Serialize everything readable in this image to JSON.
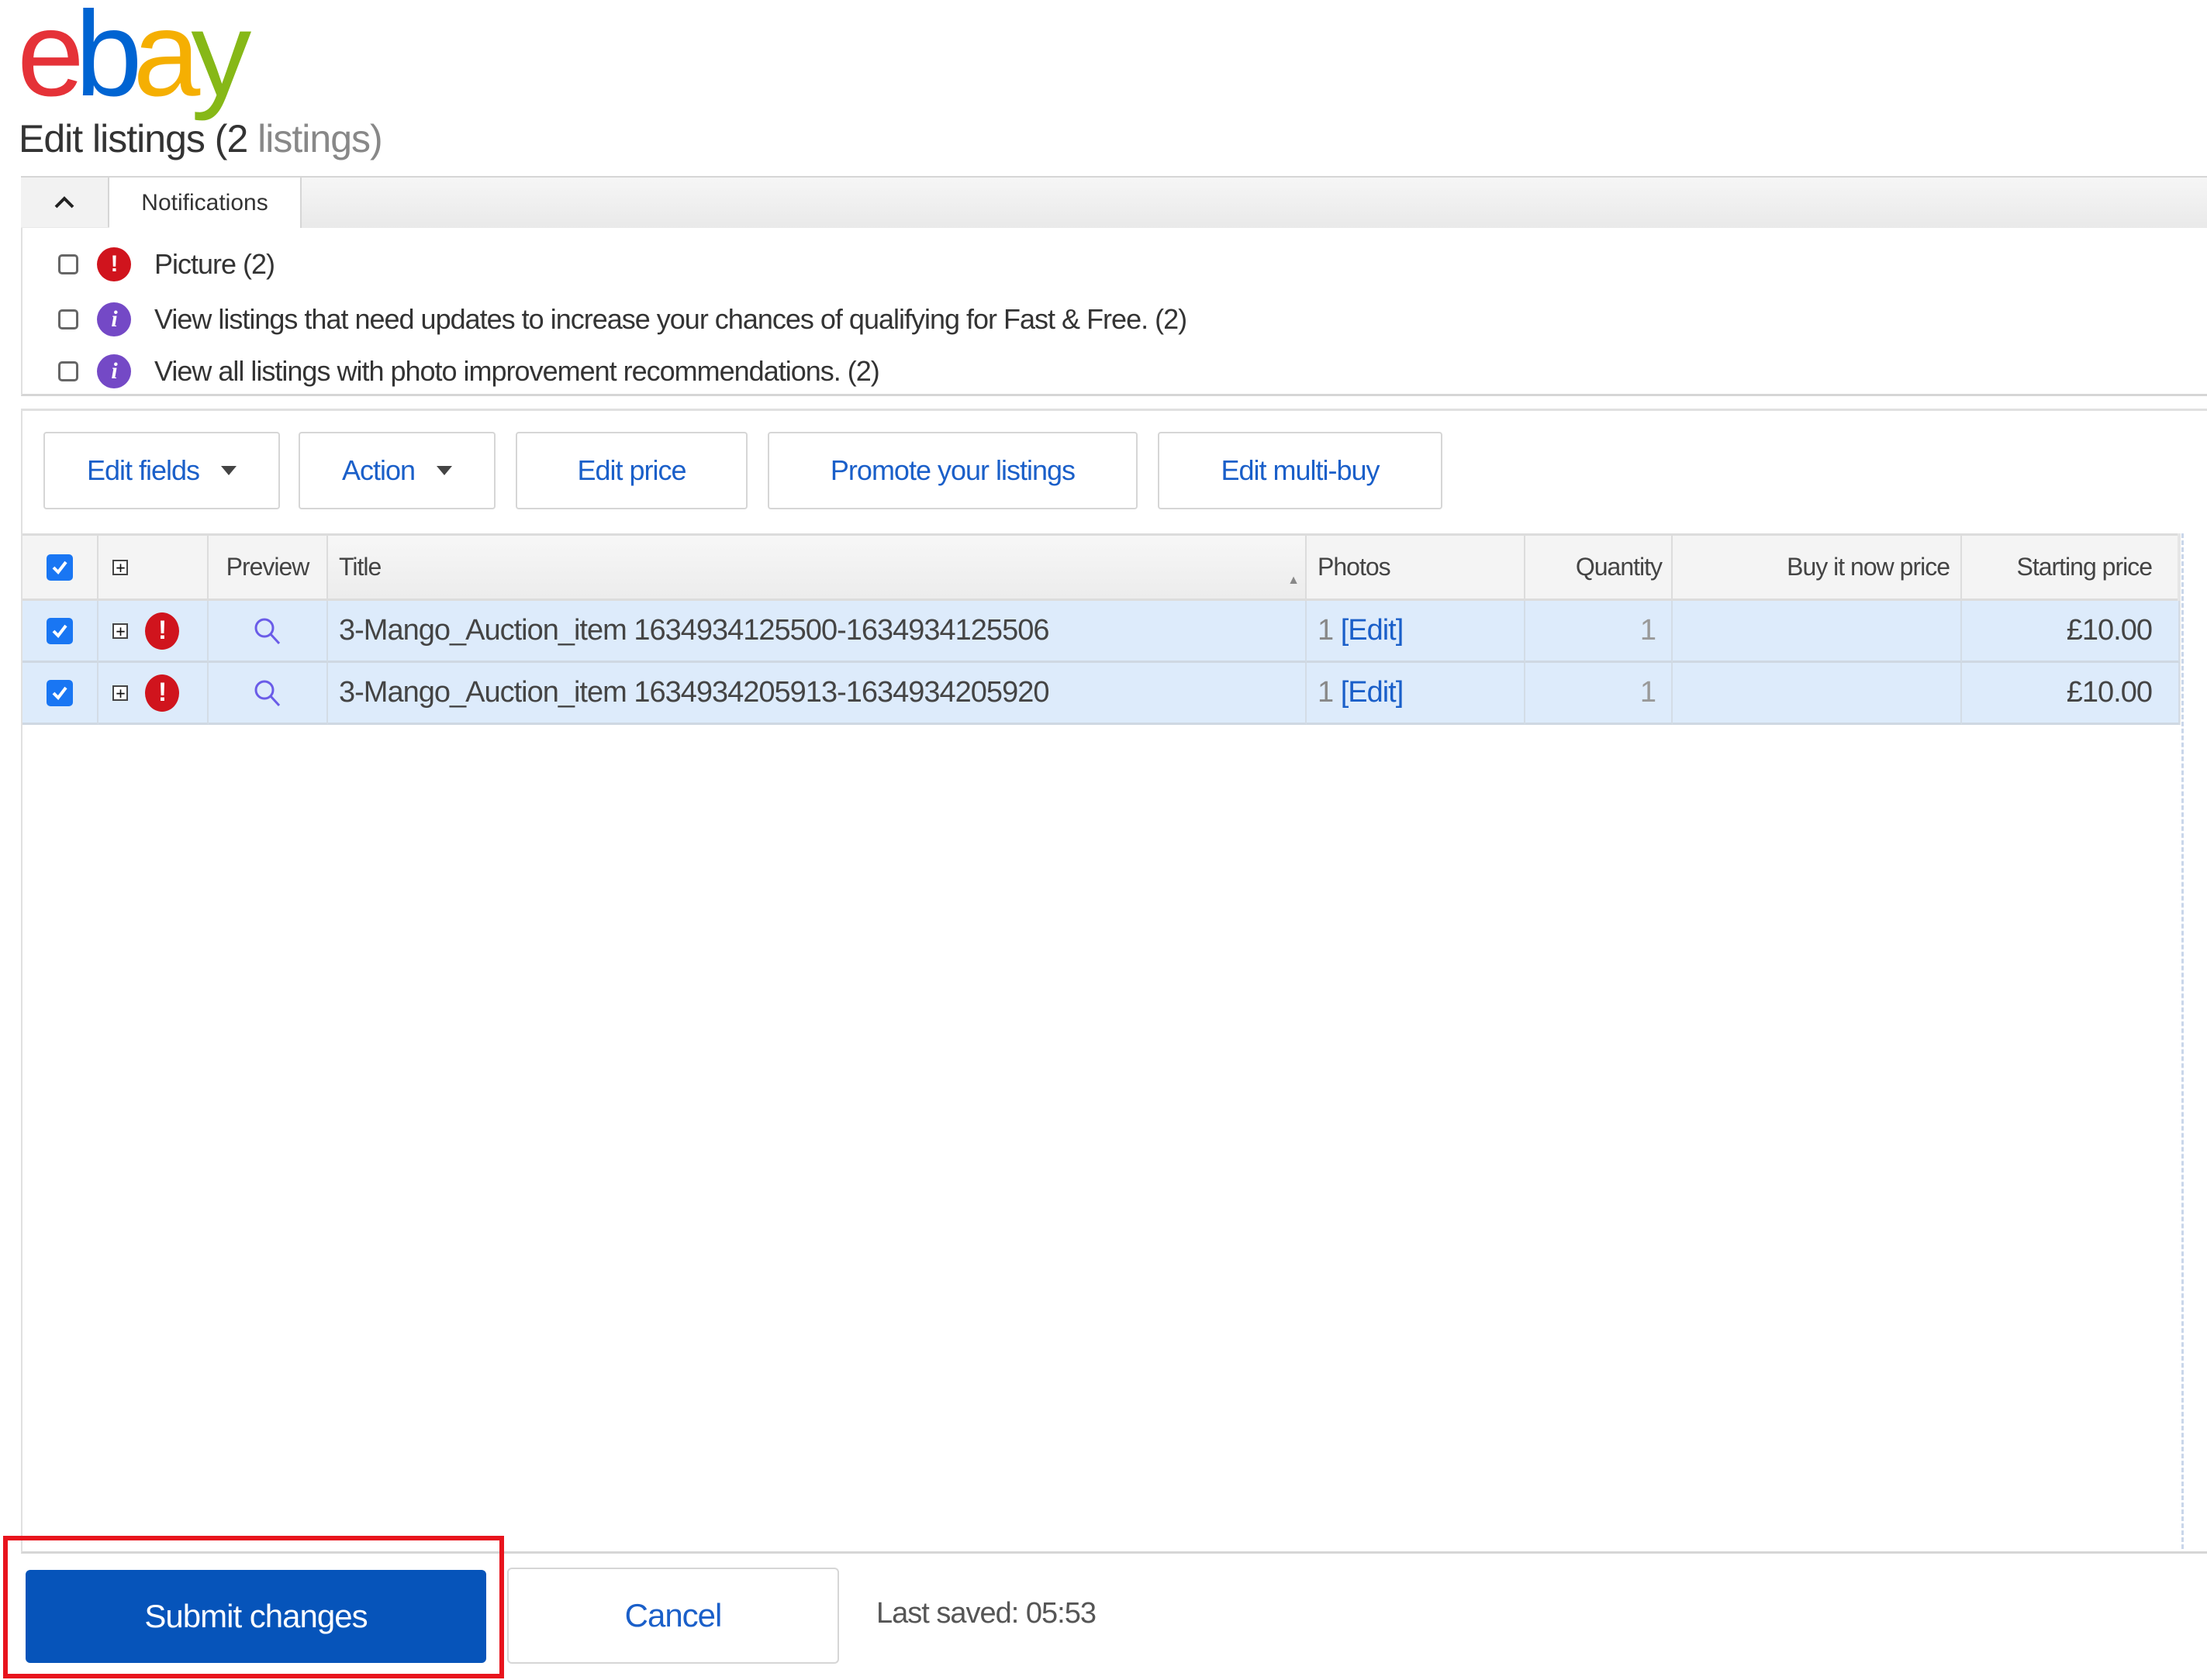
{
  "brand": {
    "logo_letters": [
      "e",
      "b",
      "a",
      "y"
    ],
    "logo_colors": [
      "#e53238",
      "#0064d2",
      "#f5af02",
      "#86b817"
    ]
  },
  "header": {
    "title_main": "Edit listings",
    "title_count": "(2",
    "title_suffix": "listings)"
  },
  "notifications": {
    "tab_label": "Notifications",
    "toggle_icon": "chevron-up-icon",
    "items": [
      {
        "icon": "error-icon",
        "icon_glyph": "!",
        "label": "Picture (2)",
        "checked": false
      },
      {
        "icon": "info-icon",
        "icon_glyph": "i",
        "label": "View listings that need updates to increase your chances of qualifying for Fast & Free. (2)",
        "checked": false
      },
      {
        "icon": "info-icon",
        "icon_glyph": "i",
        "label": "View all listings with photo improvement recommendations. (2)",
        "checked": false
      }
    ]
  },
  "toolbar": {
    "edit_fields": "Edit fields",
    "action": "Action",
    "edit_price": "Edit price",
    "promote": "Promote your listings",
    "edit_multibuy": "Edit multi-buy"
  },
  "table": {
    "columns": {
      "preview": "Preview",
      "title": "Title",
      "photos": "Photos",
      "quantity": "Quantity",
      "buy_it_now": "Buy it now price",
      "starting_price": "Starting price"
    },
    "sort": {
      "column": "title",
      "direction": "ascending"
    },
    "select_all_checked": true,
    "rows": [
      {
        "checked": true,
        "has_error": true,
        "title": "3-Mango_Auction_item 1634934125500-1634934125506",
        "photos_count": "1",
        "photos_edit": "[Edit]",
        "quantity": "1",
        "buy_it_now": "",
        "starting_price": "£10.00"
      },
      {
        "checked": true,
        "has_error": true,
        "title": "3-Mango_Auction_item 1634934205913-1634934205920",
        "photos_count": "1",
        "photos_edit": "[Edit]",
        "quantity": "1",
        "buy_it_now": "",
        "starting_price": "£10.00"
      }
    ]
  },
  "footer": {
    "submit": "Submit changes",
    "cancel": "Cancel",
    "last_saved": "Last saved: 05:53"
  },
  "colors": {
    "link": "#1a5fc9",
    "primary_button": "#0654ba",
    "selected_row": "#ddebfb",
    "error": "#d0141d",
    "info": "#7449c6",
    "highlight": "#e8141d"
  }
}
